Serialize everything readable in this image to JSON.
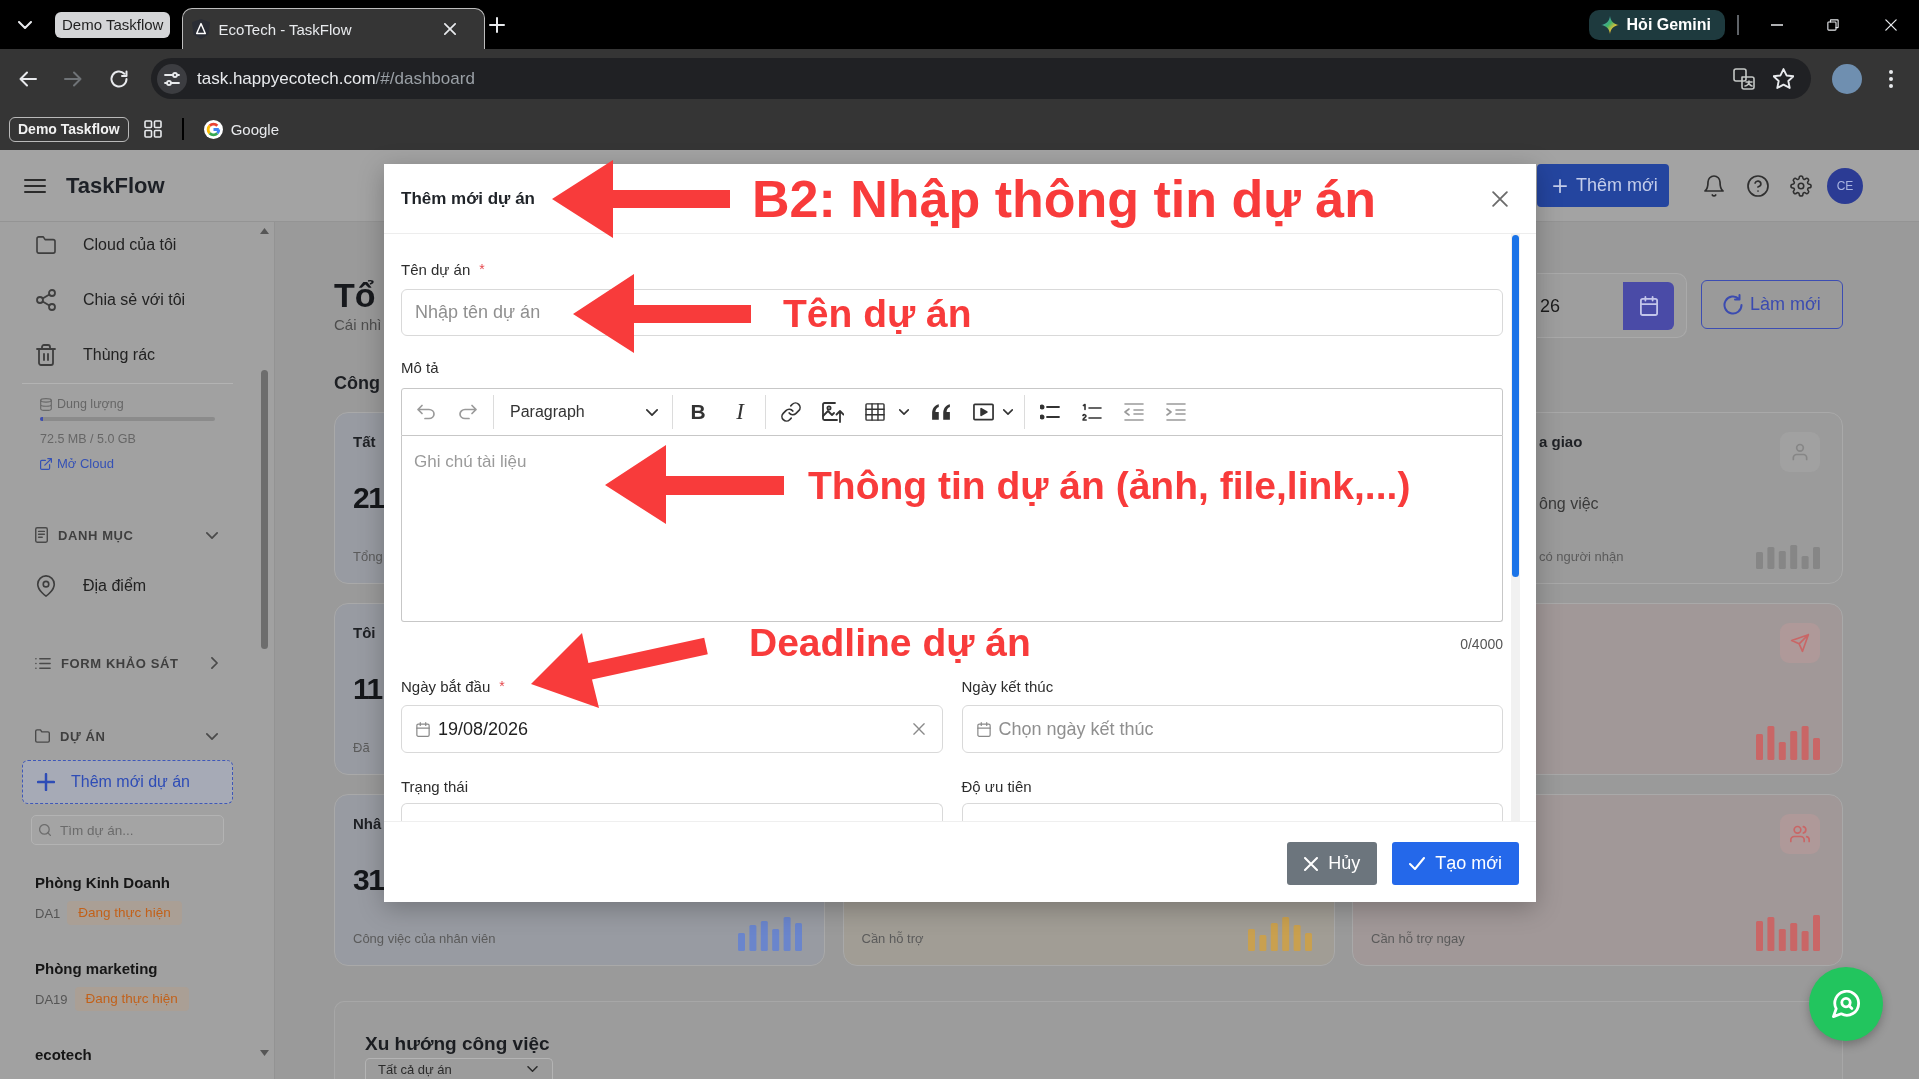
{
  "browser": {
    "tab_group": "Demo Taskflow",
    "tabs": [
      {
        "title": "EcoTech - TaskFlow",
        "selected": true
      }
    ],
    "ask_button": "Hỏi Gemini",
    "url": {
      "host": "task.happyecotech.com",
      "path": "/#/dashboard"
    },
    "bookmark_group": "Demo Taskflow",
    "bookmarks": [
      {
        "label": "Google"
      }
    ]
  },
  "header": {
    "app_name": "TaskFlow",
    "add_button": "Thêm mới",
    "avatar_initials": "CE"
  },
  "sidebar": {
    "nav": [
      {
        "label": "Cloud của tôi"
      },
      {
        "label": "Chia sẻ với tôi"
      },
      {
        "label": "Thùng rác"
      }
    ],
    "storage": {
      "label": "Dung lượng",
      "level": 0.015,
      "usage": "72.5 MB / 5.0 GB",
      "link": "Mở Cloud"
    },
    "sections": [
      {
        "title": "DANH MỤC",
        "expanded": true,
        "items": [
          {
            "label": "Địa điểm"
          }
        ]
      },
      {
        "title": "FORM KHẢO SÁT",
        "expanded": false
      },
      {
        "title": "DỰ ÁN",
        "expanded": true,
        "add_button": "Thêm mới dự án",
        "search_placeholder": "Tìm dự án...",
        "projects": [
          {
            "name": "Phòng Kinh Doanh",
            "code": "DA1",
            "status": "Đang thực hiện"
          },
          {
            "name": "Phòng marketing",
            "code": "DA19",
            "status": "Đang thực hiện"
          },
          {
            "name": "ecotech"
          }
        ]
      }
    ]
  },
  "dashboard": {
    "title": "Tổ",
    "subtitle": "Cái nhì",
    "section_title": "Công",
    "date_value": "26",
    "refresh_button": "Làm mới",
    "cards": [
      {
        "title": "Tất",
        "value": "21",
        "caption": "Tổng",
        "color": "#989ba2"
      },
      {
        "title": "a giao",
        "detail": "ông việc",
        "caption": "có người nhận",
        "color": "#868686"
      },
      {
        "title": "Tôi",
        "value": "11",
        "caption": "Đã",
        "color": "#989ba2"
      },
      {
        "color": "#c96666"
      },
      {
        "title": "Nhâ",
        "value": "31",
        "caption": "Công việc của nhân viên",
        "color": "#6a85cc"
      },
      {
        "caption": "Cần hỗ trợ",
        "color": "#c9a04f"
      },
      {
        "caption": "Cần hỗ trợ ngay",
        "color": "#c96666"
      }
    ],
    "trend": {
      "title": "Xu hướng công việc",
      "filter": "Tất cả dự án"
    }
  },
  "modal": {
    "title": "Thêm mới dự án",
    "name_field": {
      "label": "Tên dự án",
      "required_mark": "*",
      "placeholder": "Nhập tên dự án"
    },
    "description": {
      "label": "Mô tả",
      "block_style": "Paragraph",
      "bold_label": "B",
      "italic_label": "I",
      "placeholder": "Ghi chú tài liệu",
      "counter": "0/4000"
    },
    "date_fields": [
      {
        "label": "Ngày bắt đầu",
        "required_mark": "*",
        "value": "19/08/2026"
      },
      {
        "label": "Ngày kết thúc",
        "placeholder": "Chọn ngày kết thúc"
      }
    ],
    "select_fields": [
      {
        "label": "Trạng thái"
      },
      {
        "label": "Độ ưu tiên"
      }
    ],
    "buttons": [
      {
        "kind": "cancel",
        "label": "Hủy"
      },
      {
        "kind": "primary",
        "label": "Tạo mới"
      }
    ]
  },
  "annotations": [
    {
      "text": "B2: Nhập thông tin dự án"
    },
    {
      "text": "Tên dự án"
    },
    {
      "text": "Thông tin dự án (ảnh, file,link,...)"
    },
    {
      "text": "Deadline dự án"
    }
  ]
}
